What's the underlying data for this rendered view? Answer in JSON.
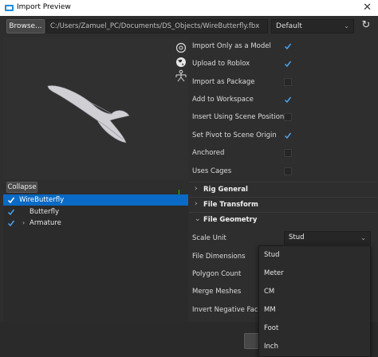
{
  "window": {
    "title": "Import Preview",
    "close_glyph": "✕"
  },
  "toolbar": {
    "browse_label": "Browse...",
    "file_path": "C:/Users/Zamuel_PC/Documents/DS_Objects/WireButterfly.fbx",
    "preset_value": "Default",
    "refresh_glyph": "↻"
  },
  "tree": {
    "collapse_label": "Collapse",
    "items": [
      {
        "label": "WireButterfly",
        "checked": true,
        "selected": true
      },
      {
        "label": "Butterfly",
        "checked": true,
        "selected": false
      },
      {
        "label": "Armature",
        "checked": true,
        "selected": false,
        "expandable": true
      }
    ]
  },
  "properties": {
    "checkboxes": [
      {
        "label": "Import Only as a Model",
        "checked": true
      },
      {
        "label": "Upload to Roblox",
        "checked": true
      },
      {
        "label": "Import as Package",
        "checked": false
      },
      {
        "label": "Add to Workspace",
        "checked": true
      },
      {
        "label": "Insert Using Scene Position",
        "checked": false
      },
      {
        "label": "Set Pivot to Scene Origin",
        "checked": true
      },
      {
        "label": "Anchored",
        "checked": false
      },
      {
        "label": "Uses Cages",
        "checked": false
      }
    ],
    "sections": [
      {
        "title": "Rig General",
        "arrow": "›"
      },
      {
        "title": "File Transform",
        "arrow": "›"
      },
      {
        "title": "File Geometry",
        "arrow": "⌄"
      }
    ],
    "geometry_rows": [
      {
        "label": "Scale Unit"
      },
      {
        "label": "File Dimensions"
      },
      {
        "label": "Polygon Count"
      },
      {
        "label": "Merge Meshes"
      },
      {
        "label": "Invert Negative Faces"
      }
    ],
    "scale_unit_value": "Stud",
    "scale_unit_options": [
      "Stud",
      "Meter",
      "CM",
      "MM",
      "Foot",
      "Inch"
    ]
  },
  "colors": {
    "accent": "#0a6ac5",
    "check": "#4aa3f0",
    "background": "#2e2e2e",
    "axis_green": "#27c000"
  },
  "icons": [
    "roblox-studio-icon",
    "close-icon",
    "chevron-down-icon",
    "refresh-icon",
    "at-symbol-icon",
    "globe-icon",
    "rig-icon",
    "checkmark-icon",
    "chevron-right-icon"
  ]
}
